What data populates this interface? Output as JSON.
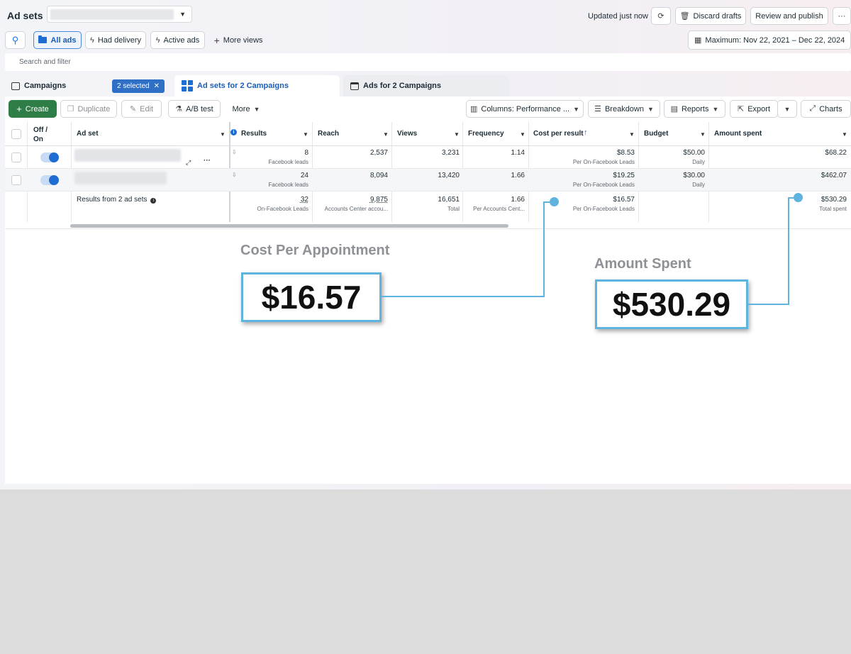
{
  "header": {
    "title": "Ad sets",
    "updated": "Updated just now",
    "discard": "Discard drafts",
    "review": "Review and publish",
    "more": "···"
  },
  "views": {
    "all_ads": "All ads",
    "had_delivery": "Had delivery",
    "active_ads": "Active ads",
    "more_views": "More views",
    "date_range": "Maximum: Nov 22, 2021 – Dec 22, 2024"
  },
  "filter": {
    "placeholder": "Search and filter"
  },
  "tabs": {
    "campaigns": "Campaigns",
    "selected": "2 selected",
    "adsets": "Ad sets for 2 Campaigns",
    "ads": "Ads for 2 Campaigns"
  },
  "toolbar": {
    "create": "Create",
    "duplicate": "Duplicate",
    "edit": "Edit",
    "ab_test": "A/B test",
    "more": "More",
    "columns": "Columns: Performance ...",
    "breakdown": "Breakdown",
    "reports": "Reports",
    "export": "Export",
    "charts": "Charts"
  },
  "table": {
    "headers": {
      "off_on_1": "Off /",
      "off_on_2": "On",
      "adset": "Ad set",
      "results": "Results",
      "reach": "Reach",
      "views": "Views",
      "frequency": "Frequency",
      "cost_per_result": "Cost per result",
      "budget": "Budget",
      "amount_spent": "Amount spent"
    },
    "rows": [
      {
        "results": "8",
        "results_sub": "Facebook leads",
        "reach": "2,537",
        "views": "3,231",
        "frequency": "1.14",
        "cpr": "$8.53",
        "cpr_sub": "Per On-Facebook Leads",
        "budget": "$50.00",
        "budget_sub": "Daily",
        "spent": "$68.22"
      },
      {
        "results": "24",
        "results_sub": "Facebook leads",
        "reach": "8,094",
        "views": "13,420",
        "frequency": "1.66",
        "cpr": "$19.25",
        "cpr_sub": "Per On-Facebook Leads",
        "budget": "$30.00",
        "budget_sub": "Daily",
        "spent": "$462.07"
      }
    ],
    "totals": {
      "label": "Results from 2 ad sets",
      "results": "32",
      "results_sub": "On-Facebook Leads",
      "reach": "9,875",
      "reach_sub": "Accounts Center accou...",
      "views": "16,651",
      "views_sub": "Total",
      "frequency": "1.66",
      "frequency_sub": "Per Accounts Cent...",
      "cpr": "$16.57",
      "cpr_sub": "Per On-Facebook Leads",
      "spent": "$530.29",
      "spent_sub": "Total spent"
    }
  },
  "annotations": {
    "cpa_label": "Cost Per Appointment",
    "cpa_value": "$16.57",
    "spent_label": "Amount Spent",
    "spent_value": "$530.29"
  },
  "colors": {
    "accent": "#1f6dd3",
    "create": "#2e7d46",
    "annotation": "#5fb3df"
  }
}
